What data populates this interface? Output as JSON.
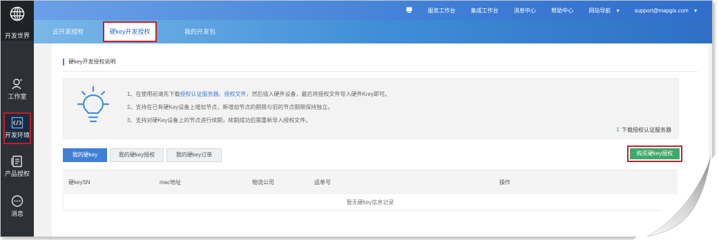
{
  "sidebar": {
    "brand_label": "开发世界",
    "items": [
      {
        "label": "工作室",
        "icon": "person-icon"
      },
      {
        "label": "开发环境",
        "icon": "code-icon",
        "active": true
      },
      {
        "label": "产品授权",
        "icon": "license-icon"
      },
      {
        "label": "消息",
        "icon": "message-icon"
      }
    ]
  },
  "topnav": {
    "items": [
      "服务工作台",
      "集成工作台",
      "消息中心",
      "帮助中心",
      "网站导航"
    ],
    "user": "support@mapgis.com"
  },
  "tabs": [
    {
      "label": "云开发授权"
    },
    {
      "label": "硬key开发授权",
      "active": true
    },
    {
      "label": "我的开发包"
    }
  ],
  "section_title": "硬key开发授权说明",
  "instructions": {
    "line1_prefix": "1、在使用前请先下载",
    "link1": "授权认证服务器",
    "sep": "、",
    "link2": "授权文件",
    "line1_suffix": "，然后插入硬件设备，最后将授权文件导入硬件Krey即可。",
    "line2": "2、支持在已有硬Key设备上增加节点，新增加节点的期限与旧的节点期限保持独立。",
    "line3": "3、支持对硬Key设备上的节点进行续期，续期成功后需重新导入授权文件。"
  },
  "download_label": "下载授权认证服务器",
  "subtabs": [
    "我的硬key",
    "我的硬key授权",
    "我的硬key订单"
  ],
  "buy_button": "购买硬key授权",
  "table": {
    "columns": [
      "硬keySN",
      "mac地址",
      "物流公司",
      "运单号",
      "操作"
    ],
    "empty_text": "暂无硬key信息记录"
  },
  "colors": {
    "accent": "#3f7fd6",
    "highlight": "#c0202a",
    "buy": "#3fa86a"
  }
}
